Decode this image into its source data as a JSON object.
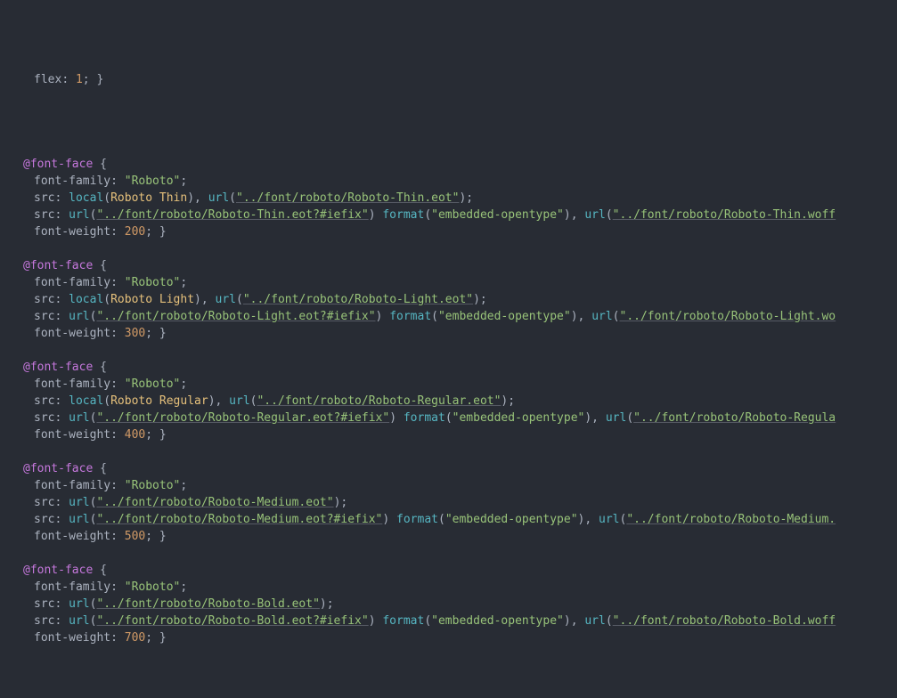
{
  "colors": {
    "background": "#282c34",
    "foreground": "#abb2bf",
    "keyword": "#c678dd",
    "number": "#d19a66",
    "string": "#98c379",
    "function": "#56b6c2",
    "identifier": "#e5c07b"
  },
  "topLine": {
    "prop": "flex",
    "value": "1"
  },
  "constants": {
    "atRule": "@font-face",
    "familyProp": "font-family",
    "srcProp": "src",
    "weightProp": "font-weight",
    "localFn": "local",
    "urlFn": "url",
    "formatFn": "format",
    "embeddedOpentype": "\"embedded-opentype\""
  },
  "blocks": [
    {
      "family": "\"Roboto\"",
      "localName": "Roboto Thin",
      "firstUrl": "\"../font/roboto/Roboto-Thin.eot\"",
      "iefixUrl": "\"../font/roboto/Roboto-Thin.eot?#iefix\"",
      "secondUrl": "\"../font/roboto/Roboto-Thin.woff",
      "hasLocal": true,
      "weight": "200"
    },
    {
      "family": "\"Roboto\"",
      "localName": "Roboto Light",
      "firstUrl": "\"../font/roboto/Roboto-Light.eot\"",
      "iefixUrl": "\"../font/roboto/Roboto-Light.eot?#iefix\"",
      "secondUrl": "\"../font/roboto/Roboto-Light.wo",
      "hasLocal": true,
      "weight": "300"
    },
    {
      "family": "\"Roboto\"",
      "localName": "Roboto Regular",
      "firstUrl": "\"../font/roboto/Roboto-Regular.eot\"",
      "iefixUrl": "\"../font/roboto/Roboto-Regular.eot?#iefix\"",
      "secondUrl": "\"../font/roboto/Roboto-Regula",
      "hasLocal": true,
      "weight": "400"
    },
    {
      "family": "\"Roboto\"",
      "firstUrl": "\"../font/roboto/Roboto-Medium.eot\"",
      "iefixUrl": "\"../font/roboto/Roboto-Medium.eot?#iefix\"",
      "secondUrl": "\"../font/roboto/Roboto-Medium.",
      "hasLocal": false,
      "weight": "500"
    },
    {
      "family": "\"Roboto\"",
      "firstUrl": "\"../font/roboto/Roboto-Bold.eot\"",
      "iefixUrl": "\"../font/roboto/Roboto-Bold.eot?#iefix\"",
      "secondUrl": "\"../font/roboto/Roboto-Bold.woff",
      "hasLocal": false,
      "weight": "700"
    }
  ]
}
